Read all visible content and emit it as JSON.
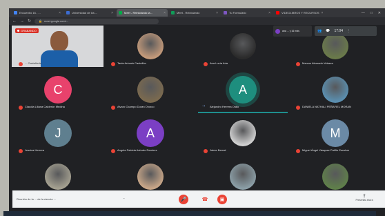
{
  "browser": {
    "tabs": [
      {
        "label": "Encuentro 16 - ...",
        "color": "#4285f4"
      },
      {
        "label": "Universidad de los ...",
        "color": "#3c6cd1"
      },
      {
        "label": "Meet - Reiniciando la...",
        "color": "#00ac47",
        "active": true
      },
      {
        "label": "Meet - Reiniciando",
        "color": "#0f9d58"
      },
      {
        "label": "Tu Formulario",
        "color": "#7e57c2"
      },
      {
        "label": "VIDEOLIBROS Y RECURSOS",
        "color": "#ff0000"
      }
    ],
    "url": "meet.google.com/..."
  },
  "recording_label": "GRABANDO",
  "toolbar": {
    "toast_text": "ana ...  y 16 más",
    "time": "17:04"
  },
  "participants": [
    {
      "name": "... Castañeda",
      "type": "video",
      "bg": "#d7d8da",
      "muted": true
    },
    {
      "name": "Tania Arévalo Castellón",
      "type": "photo",
      "bg": "#c49a7a",
      "muted": true
    },
    {
      "name": "Ana Lucía Aria",
      "type": "photo",
      "bg": "#2b2b2b",
      "muted": true
    },
    {
      "name": "Marcos Alvarado Velasco",
      "type": "photo",
      "bg": "#6a7a4a",
      "muted": true
    },
    {
      "name": "Claudia Liliana Calderón Medina",
      "type": "letter",
      "letter": "C",
      "bg": "#e8426c",
      "muted": true
    },
    {
      "name": "Alvaro Ocampo Duran Orozco",
      "type": "photo",
      "bg": "#7b6a4f",
      "muted": true
    },
    {
      "name": "Alejandro Herrera Otálo",
      "type": "letter",
      "letter": "A",
      "bg": "#1e8e7e",
      "muted": false,
      "speaking": true
    },
    {
      "name": "DANIELA NATHALI PEÑAFIEL MORAN",
      "type": "photo",
      "bg": "#5b8fb0",
      "muted": true
    },
    {
      "name": "Jessica Herrera",
      "type": "letter",
      "letter": "J",
      "bg": "#5f7f8f",
      "muted": true
    },
    {
      "name": "Angela Patricia Arévalo Ramírez",
      "type": "letter",
      "letter": "A",
      "bg": "#7b3fc4",
      "muted": true
    },
    {
      "name": "Jaime Bernal",
      "type": "photo",
      "bg": "#d0d0d0",
      "muted": true
    },
    {
      "name": "Miguel Ángel Vásquez Patiño Escobar",
      "type": "letter",
      "letter": "M",
      "bg": "#6b8aa6",
      "muted": true
    },
    {
      "name": "",
      "type": "photo",
      "bg": "#a4a090",
      "muted": false
    },
    {
      "name": "",
      "type": "photo",
      "bg": "#c8a688",
      "muted": false
    },
    {
      "name": "",
      "type": "photo",
      "bg": "#8b9ea6",
      "muted": false
    },
    {
      "name": "",
      "type": "photo",
      "bg": "#5f7f4a",
      "muted": false
    }
  ],
  "bottom": {
    "meeting_title": "Reunión de la ... de la ciencia ...",
    "present_label": "Presentar ahora"
  }
}
